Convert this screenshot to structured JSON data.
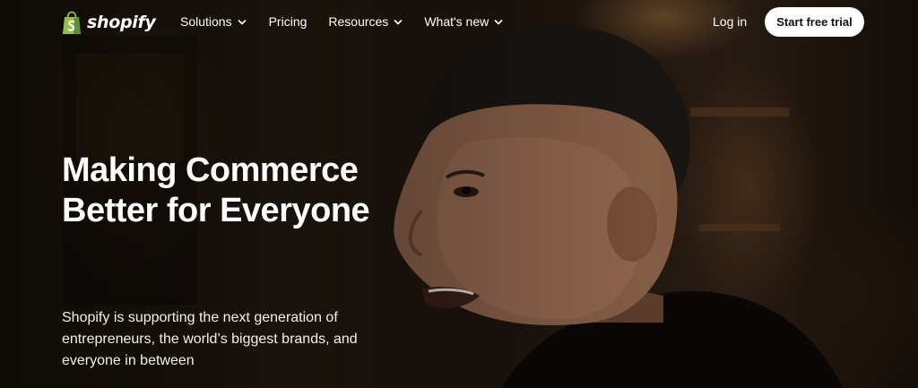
{
  "brand": {
    "name": "shopify",
    "logo_color": "#95bf47"
  },
  "nav": {
    "items": [
      {
        "label": "Solutions",
        "has_dropdown": true
      },
      {
        "label": "Pricing",
        "has_dropdown": false
      },
      {
        "label": "Resources",
        "has_dropdown": true
      },
      {
        "label": "What's new",
        "has_dropdown": true
      }
    ],
    "login_label": "Log in",
    "cta_label": "Start free trial"
  },
  "hero": {
    "headline": "Making Commerce Better for Everyone",
    "subheading": "Shopify is supporting the next generation of entrepreneurs, the world’s biggest brands, and everyone in between",
    "background": "video still of a man speaking"
  },
  "colors": {
    "cta_bg": "#ffffff",
    "cta_text": "#111111",
    "text": "#ffffff"
  }
}
